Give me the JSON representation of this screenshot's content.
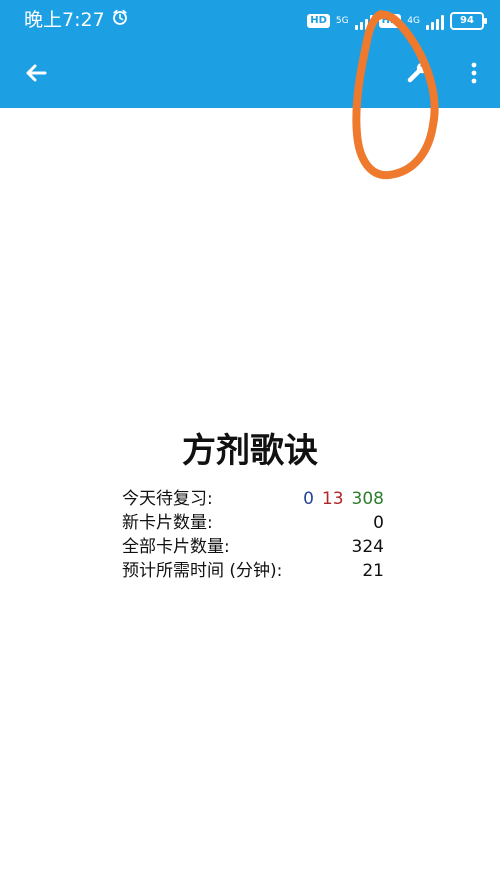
{
  "status_bar": {
    "time_label": "晚上7:27",
    "hd_1": "HD",
    "net_1": "5G",
    "hd_2": "HD",
    "net_2": "4G",
    "battery_level": "94"
  },
  "app_bar": {
    "back_icon": "arrow-back-icon",
    "settings_icon": "wrench-icon",
    "menu_icon": "more-vert-icon"
  },
  "deck": {
    "title": "方剂歌诀",
    "stats": {
      "due_today_label": "今天待复习:",
      "due_new": "0",
      "due_learning": "13",
      "due_review": "308",
      "new_cards_label": "新卡片数量:",
      "new_cards_value": "0",
      "total_cards_label": "全部卡片数量:",
      "total_cards_value": "324",
      "estimated_time_label": "预计所需时间 (分钟):",
      "estimated_time_value": "21"
    }
  },
  "colors": {
    "app_bar": "#1c9fe3",
    "new_count": "#24469a",
    "learning_count": "#b22525",
    "review_count": "#2e7d2e",
    "annotation": "#ef7a2d"
  }
}
